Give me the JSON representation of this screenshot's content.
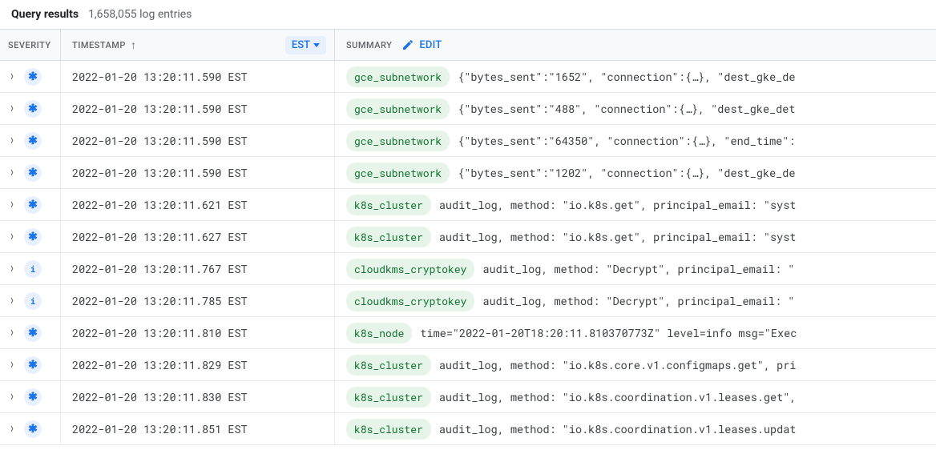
{
  "header": {
    "title": "Query results",
    "count": "1,658,055 log entries"
  },
  "columns": {
    "severity": "SEVERITY",
    "timestamp": "TIMESTAMP",
    "summary": "SUMMARY",
    "timezone": "EST",
    "edit": "EDIT"
  },
  "rows": [
    {
      "severity": "default",
      "timestamp": "2022-01-20 13:20:11.590 EST",
      "resource": "gce_subnetwork",
      "summary": "{\"bytes_sent\":\"1652\", \"connection\":{…}, \"dest_gke_de"
    },
    {
      "severity": "default",
      "timestamp": "2022-01-20 13:20:11.590 EST",
      "resource": "gce_subnetwork",
      "summary": "{\"bytes_sent\":\"488\", \"connection\":{…}, \"dest_gke_det"
    },
    {
      "severity": "default",
      "timestamp": "2022-01-20 13:20:11.590 EST",
      "resource": "gce_subnetwork",
      "summary": "{\"bytes_sent\":\"64350\", \"connection\":{…}, \"end_time\":"
    },
    {
      "severity": "default",
      "timestamp": "2022-01-20 13:20:11.590 EST",
      "resource": "gce_subnetwork",
      "summary": "{\"bytes_sent\":\"1202\", \"connection\":{…}, \"dest_gke_de"
    },
    {
      "severity": "default",
      "timestamp": "2022-01-20 13:20:11.621 EST",
      "resource": "k8s_cluster",
      "summary": "audit_log, method: \"io.k8s.get\", principal_email: \"syst"
    },
    {
      "severity": "default",
      "timestamp": "2022-01-20 13:20:11.627 EST",
      "resource": "k8s_cluster",
      "summary": "audit_log, method: \"io.k8s.get\", principal_email: \"syst"
    },
    {
      "severity": "info",
      "timestamp": "2022-01-20 13:20:11.767 EST",
      "resource": "cloudkms_cryptokey",
      "summary": "audit_log, method: \"Decrypt\", principal_email: \""
    },
    {
      "severity": "info",
      "timestamp": "2022-01-20 13:20:11.785 EST",
      "resource": "cloudkms_cryptokey",
      "summary": "audit_log, method: \"Decrypt\", principal_email: \""
    },
    {
      "severity": "default",
      "timestamp": "2022-01-20 13:20:11.810 EST",
      "resource": "k8s_node",
      "summary": "time=\"2022-01-20T18:20:11.810370773Z\" level=info msg=\"Exec"
    },
    {
      "severity": "default",
      "timestamp": "2022-01-20 13:20:11.829 EST",
      "resource": "k8s_cluster",
      "summary": "audit_log, method: \"io.k8s.core.v1.configmaps.get\", pri"
    },
    {
      "severity": "default",
      "timestamp": "2022-01-20 13:20:11.830 EST",
      "resource": "k8s_cluster",
      "summary": "audit_log, method: \"io.k8s.coordination.v1.leases.get\","
    },
    {
      "severity": "default",
      "timestamp": "2022-01-20 13:20:11.851 EST",
      "resource": "k8s_cluster",
      "summary": "audit_log, method: \"io.k8s.coordination.v1.leases.updat"
    }
  ]
}
